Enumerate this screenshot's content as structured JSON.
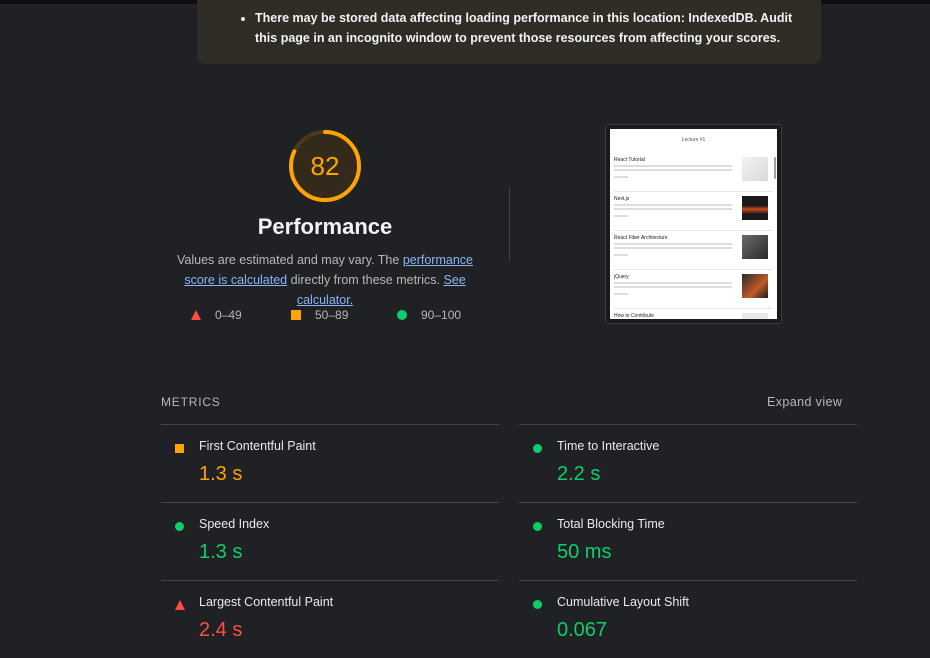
{
  "warning": {
    "text": "There may be stored data affecting loading performance in this location: IndexedDB. Audit this page in an incognito window to prevent those resources from affecting your scores."
  },
  "score": {
    "value": "82",
    "fraction": 0.82,
    "color": "#ffa400",
    "label": "Performance",
    "desc_part1": "Values are estimated and may vary. The ",
    "desc_link1": "performance score is calculated",
    "desc_part2": " directly from these metrics. ",
    "desc_link2": "See calculator."
  },
  "legend": [
    {
      "range": "0–49",
      "shape": "triangle",
      "color": "#ff4e42"
    },
    {
      "range": "50–89",
      "shape": "square",
      "color": "#ffa400"
    },
    {
      "range": "90–100",
      "shape": "circle",
      "color": "#0cce6b"
    }
  ],
  "thumbnail": {
    "title": "Lecture #1",
    "items": [
      "React Tutorial",
      "Next.js",
      "React Fiber Architecture",
      "jQuery",
      "How to Contribute"
    ]
  },
  "metrics": {
    "header": "METRICS",
    "expand_label": "Expand view",
    "items": [
      {
        "name": "First Contentful Paint",
        "value": "1.3 s",
        "status": "average",
        "color": "#ffa400"
      },
      {
        "name": "Time to Interactive",
        "value": "2.2 s",
        "status": "pass",
        "color": "#0cce6b"
      },
      {
        "name": "Speed Index",
        "value": "1.3 s",
        "status": "pass",
        "color": "#0cce6b"
      },
      {
        "name": "Total Blocking Time",
        "value": "50 ms",
        "status": "pass",
        "color": "#0cce6b"
      },
      {
        "name": "Largest Contentful Paint",
        "value": "2.4 s",
        "status": "fail",
        "color": "#ff4e42"
      },
      {
        "name": "Cumulative Layout Shift",
        "value": "0.067",
        "status": "pass",
        "color": "#0cce6b"
      }
    ]
  }
}
